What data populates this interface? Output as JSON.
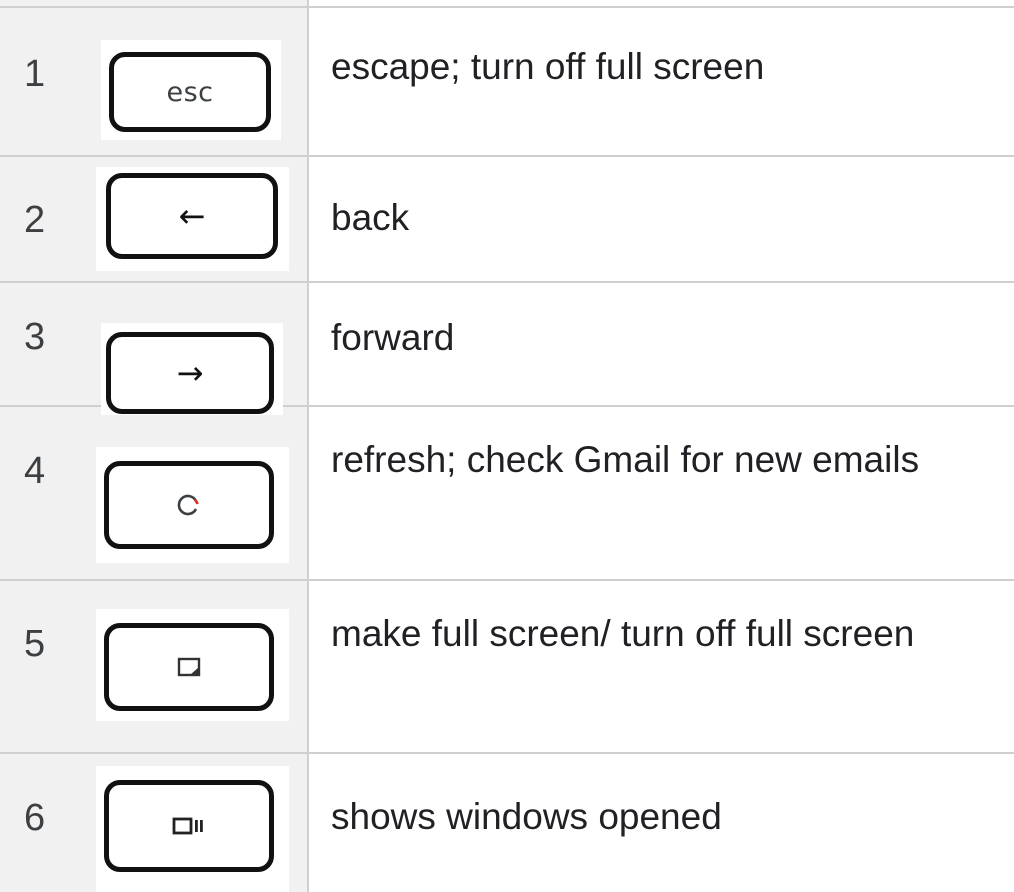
{
  "rows": [
    {
      "number": "1",
      "key_label": "esc",
      "key_icon": "esc-key",
      "description": "escape; turn off full screen"
    },
    {
      "number": "2",
      "key_label": "←",
      "key_icon": "back-arrow-icon",
      "description": "back"
    },
    {
      "number": "3",
      "key_label": "→",
      "key_icon": "forward-arrow-icon",
      "description": "forward"
    },
    {
      "number": "4",
      "key_label": "",
      "key_icon": "refresh-icon",
      "description": "refresh; check Gmail for new emails"
    },
    {
      "number": "5",
      "key_label": "",
      "key_icon": "fullscreen-icon",
      "description": "make full screen/ turn off full screen"
    },
    {
      "number": "6",
      "key_label": "",
      "key_icon": "show-windows-icon",
      "description": "shows windows opened"
    }
  ],
  "colors": {
    "grid": "#cfcfcf",
    "left_column_bg": "#f1f1f1",
    "text": "#202124",
    "refresh_accent": "#d93025"
  }
}
